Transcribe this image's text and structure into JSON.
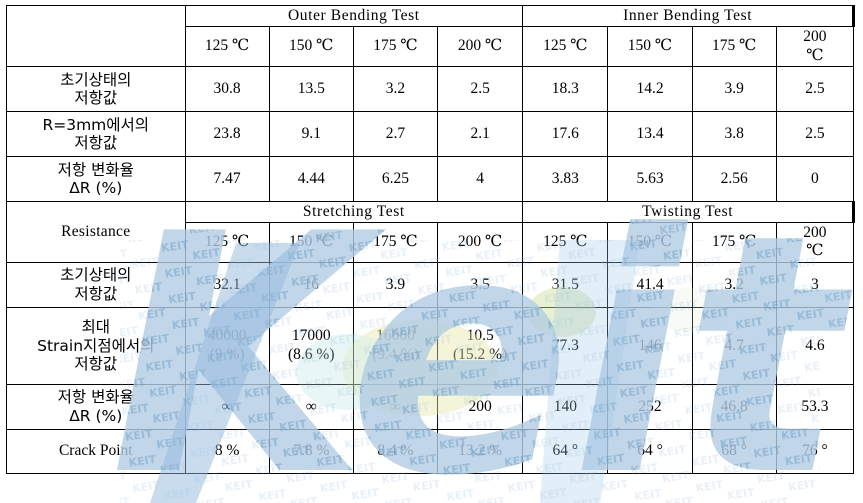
{
  "table": {
    "row_label_header": "",
    "groups_top": [
      {
        "name": "outer-bending-test",
        "label": "Outer Bending Test"
      },
      {
        "name": "inner-bending-test",
        "label": "Inner Bending Test"
      }
    ],
    "groups_bottom": [
      {
        "name": "stretching-test",
        "label": "Stretching Test"
      },
      {
        "name": "twisting-test",
        "label": "Twisting Test"
      }
    ],
    "temperatures": [
      "125 ℃",
      "150 ℃",
      "175 ℃",
      "200 ℃"
    ],
    "temperature_last": "200\n℃",
    "section_label": "Resistance",
    "top_rows": [
      {
        "label": "초기상태의\n저항값",
        "values": [
          "30.8",
          "13.5",
          "3.2",
          "2.5",
          "18.3",
          "14.2",
          "3.9",
          "2.5"
        ]
      },
      {
        "label": "R=3mm에서의\n저항값",
        "values": [
          "23.8",
          "9.1",
          "2.7",
          "2.1",
          "17.6",
          "13.4",
          "3.8",
          "2.5"
        ]
      },
      {
        "label": "저항 변화율\nΔR (%)",
        "values": [
          "7.47",
          "4.44",
          "6.25",
          "4",
          "3.83",
          "5.63",
          "2.56",
          "0"
        ]
      }
    ],
    "bottom_rows": [
      {
        "label": "초기상태의\n저항값",
        "values": [
          "32.1",
          "16",
          "3.9",
          "3.5",
          "31.5",
          "41.4",
          "3.2",
          "3"
        ]
      },
      {
        "label": "최대\nStrain지점에서의\n저항값",
        "values": [
          "40000\n(9 %)",
          "17000\n(8.6 %)",
          "16000\n(9.4 %)",
          "10.5\n(15.2 %)",
          "77.3",
          "146",
          "4.7",
          "4.6"
        ]
      },
      {
        "label": "저항 변화율\nΔR (%)",
        "values": [
          "∞",
          "∞",
          "∞",
          "200",
          "140",
          "252",
          "46.8",
          "53.3"
        ]
      },
      {
        "label": "Crack Point",
        "values": [
          "8 %",
          "7.8 %",
          "8.4 %",
          "13.2 %",
          "64 °",
          "64 °",
          "68 °",
          "76 °"
        ]
      }
    ]
  },
  "watermark": {
    "text": "Keit",
    "tile_text": "KEIT",
    "color_blue": "#b9cfe6",
    "color_lightblue": "#a9d6ec",
    "color_green": "#cfe0a0",
    "color_yellow": "#e8e8a8"
  }
}
